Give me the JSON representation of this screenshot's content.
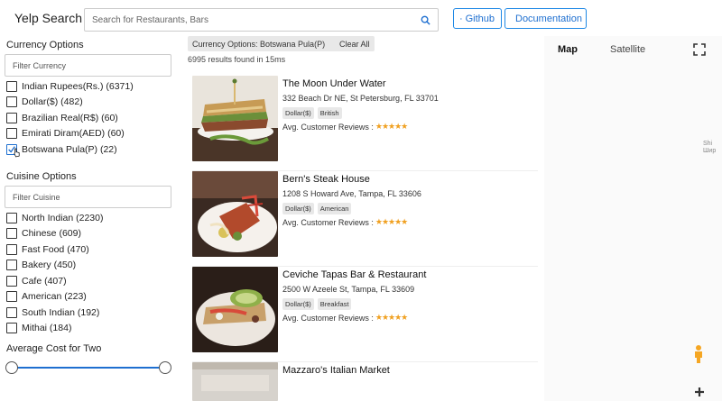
{
  "header": {
    "brand": "Yelp Search",
    "search_placeholder": "Search for Restaurants, Bars",
    "github_label": "Github",
    "docs_label": "Documentation"
  },
  "sidebar": {
    "currency": {
      "title": "Currency Options",
      "filter_placeholder": "Filter Currency",
      "items": [
        {
          "label": "Indian Rupees(Rs.) (6371)",
          "checked": false
        },
        {
          "label": "Dollar($) (482)",
          "checked": false
        },
        {
          "label": "Brazilian Real(R$) (60)",
          "checked": false
        },
        {
          "label": "Emirati Diram(AED) (60)",
          "checked": false
        },
        {
          "label": "Botswana Pula(P) (22)",
          "checked": true
        }
      ]
    },
    "cuisine": {
      "title": "Cuisine Options",
      "filter_placeholder": "Filter Cuisine",
      "items": [
        {
          "label": "North Indian (2230)",
          "checked": false
        },
        {
          "label": "Chinese (609)",
          "checked": false
        },
        {
          "label": "Fast Food (470)",
          "checked": false
        },
        {
          "label": "Bakery (450)",
          "checked": false
        },
        {
          "label": "Cafe (407)",
          "checked": false
        },
        {
          "label": "American (223)",
          "checked": false
        },
        {
          "label": "South Indian (192)",
          "checked": false
        },
        {
          "label": "Mithai (184)",
          "checked": false
        }
      ]
    },
    "cost": {
      "title": "Average Cost for Two",
      "range_fraction": [
        0,
        1
      ]
    }
  },
  "filters": {
    "active_chip": "Currency Options: Botswana Pula(P)",
    "clear_all": "Clear All",
    "results_count": "6995 results found in 15ms"
  },
  "results": [
    {
      "name": "The Moon Under Water",
      "address": "332 Beach Dr NE, St Petersburg, FL 33701",
      "tags": [
        "Dollar($)",
        "British"
      ],
      "review_label": "Avg. Customer Reviews :",
      "stars": "★★★★★"
    },
    {
      "name": "Bern's Steak House",
      "address": "1208 S Howard Ave, Tampa, FL 33606",
      "tags": [
        "Dollar($)",
        "American"
      ],
      "review_label": "Avg. Customer Reviews :",
      "stars": "★★★★★"
    },
    {
      "name": "Ceviche Tapas Bar & Restaurant",
      "address": "2500 W Azeele St, Tampa, FL 33609",
      "tags": [
        "Dollar($)",
        "Breakfast"
      ],
      "review_label": "Avg. Customer Reviews :",
      "stars": "★★★★★"
    },
    {
      "name": "Mazzaro's Italian Market",
      "address": "",
      "tags": [],
      "review_label": "",
      "stars": ""
    }
  ],
  "map": {
    "tab_map": "Map",
    "tab_satellite": "Satellite",
    "edge_label_1": "Shi",
    "edge_label_2": "Шир"
  }
}
